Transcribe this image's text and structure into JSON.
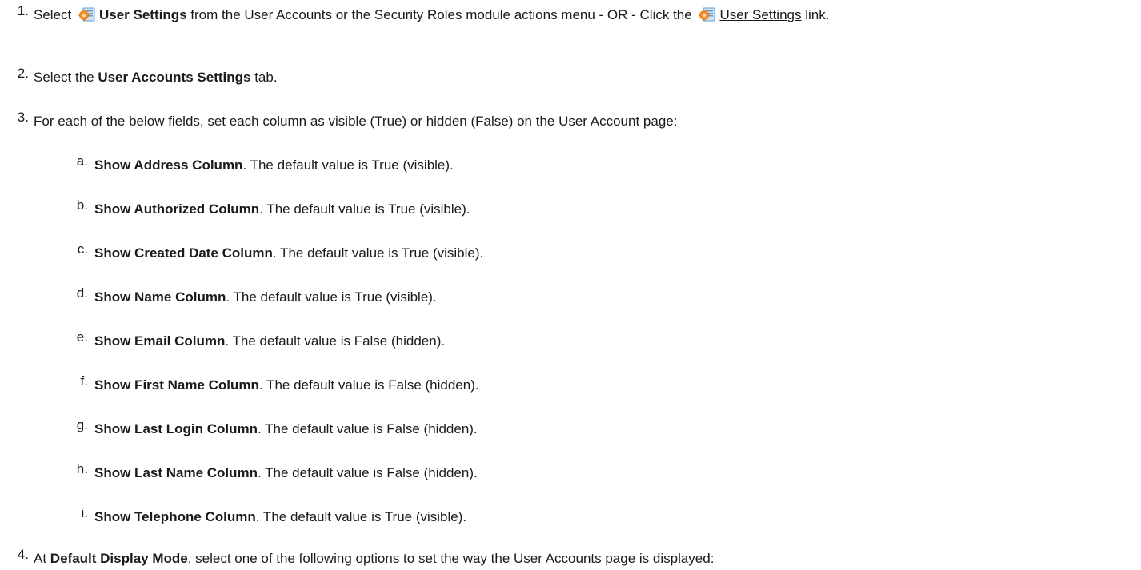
{
  "icons": {
    "user_settings": "user-settings-icon"
  },
  "steps": [
    {
      "number": "1",
      "pre": "Select ",
      "bold1": "User Settings",
      "mid": " from the User Accounts or the Security Roles module actions menu - OR - Click the ",
      "link": "User Settings",
      "post": " link."
    },
    {
      "number": "2",
      "pre": "Select the ",
      "bold": "User Accounts Settings",
      "post": " tab."
    },
    {
      "number": "3",
      "text": "For each of the below fields, set each column as visible (True) or hidden (False) on the User Account page:"
    },
    {
      "number": "4",
      "pre": "At ",
      "bold": "Default Display Mode",
      "post": ", select one of the following options to set the way the User Accounts page is displayed:"
    }
  ],
  "substeps": [
    {
      "letter": "a",
      "bold": "Show Address Column",
      "text": ". The default value is True (visible)."
    },
    {
      "letter": "b",
      "bold": "Show Authorized Column",
      "text": ". The default value is True (visible)."
    },
    {
      "letter": "c",
      "bold": "Show Created Date Column",
      "text": ". The default value is True (visible)."
    },
    {
      "letter": "d",
      "bold": "Show Name Column",
      "text": ". The default value is True (visible)."
    },
    {
      "letter": "e",
      "bold": "Show Email Column",
      "text": ". The default value is False (hidden)."
    },
    {
      "letter": "f",
      "bold": "Show First Name Column",
      "text": ". The default value is False (hidden)."
    },
    {
      "letter": "g",
      "bold": "Show Last Login Column",
      "text": ". The default value is False (hidden)."
    },
    {
      "letter": "h",
      "bold": "Show Last Name Column",
      "text": ". The default value is False (hidden)."
    },
    {
      "letter": "i",
      "bold": "Show Telephone Column",
      "text": ". The default value is True (visible)."
    }
  ]
}
